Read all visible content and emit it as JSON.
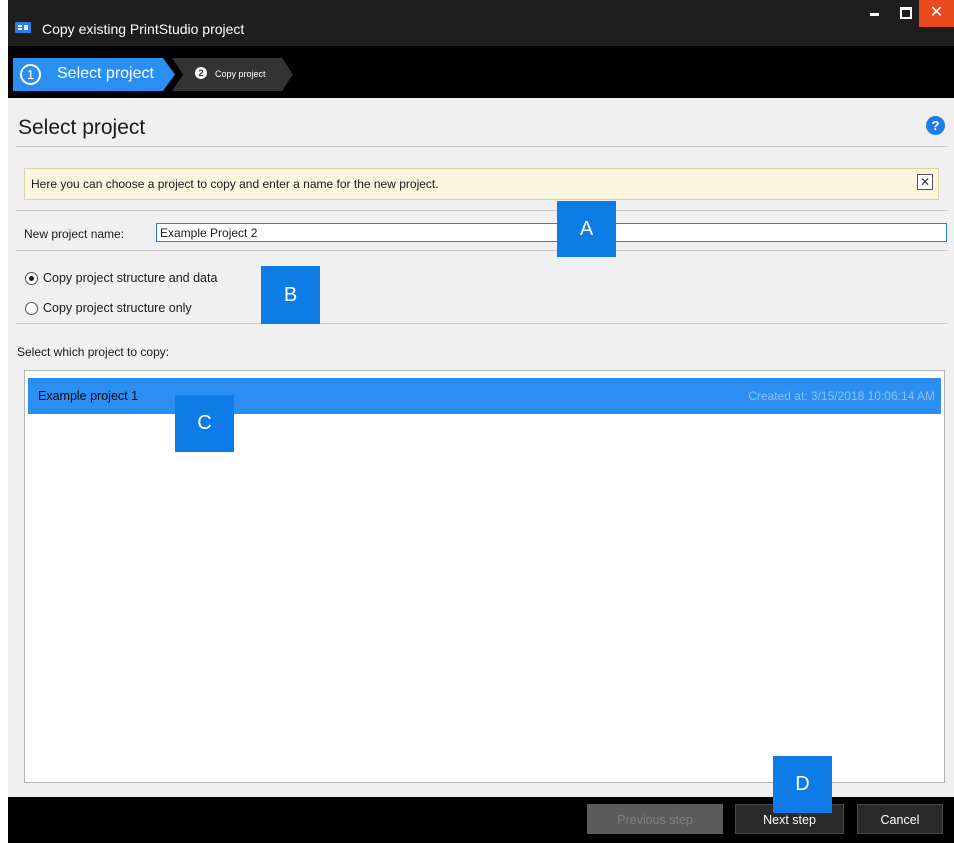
{
  "window": {
    "title": "Copy existing PrintStudio project",
    "controls": {
      "minimize": "minimize",
      "maximize": "maximize",
      "close": "✕"
    }
  },
  "steps": [
    {
      "number": "1",
      "label": "Select project",
      "active": true
    },
    {
      "number": "2",
      "label": "Copy project",
      "active": false
    }
  ],
  "header": {
    "title": "Select project",
    "help": "?"
  },
  "info": {
    "text": "Here you can choose a project to copy and enter a name for the new project.",
    "close": "✕"
  },
  "form": {
    "name_label": "New project name:",
    "name_value": "Example Project 2",
    "options": [
      {
        "label": "Copy project structure and data",
        "checked": true
      },
      {
        "label": "Copy project structure only",
        "checked": false
      }
    ],
    "select_label": "Select which project to copy:"
  },
  "projects": [
    {
      "name": "Example project 1",
      "created": "Created at: 3/15/2018 10:06:14 AM",
      "selected": true
    }
  ],
  "footer": {
    "previous": "Previous step",
    "next": "Next step",
    "cancel": "Cancel"
  },
  "callouts": [
    "A",
    "B",
    "C",
    "D"
  ],
  "colors": {
    "accent": "#2b8ef2",
    "callout": "#0f7be6",
    "close": "#e8491d",
    "info_bg": "#f8f6dc"
  }
}
